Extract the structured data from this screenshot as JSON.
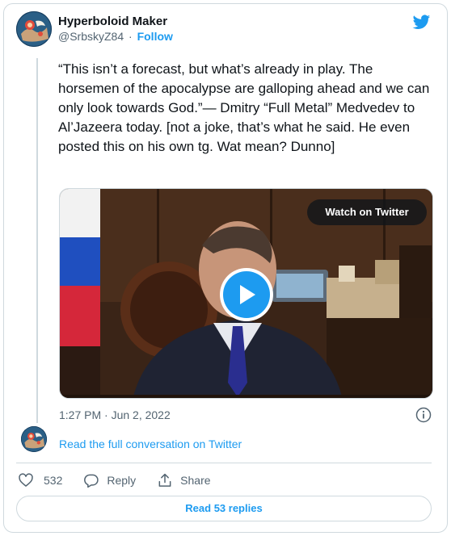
{
  "author": {
    "name": "Hyperboloid Maker",
    "handle": "@SrbskyZ84",
    "separator": "·",
    "follow_label": "Follow"
  },
  "tweet": {
    "text": "“This isn’t a forecast, but what’s already in play. The horsemen of the apocalypse are galloping ahead and we can only look towards God.”— Dmitry “Full Metal” Medvedev to Al’Jazeera today. [not a joke, that’s what he said. He even posted this on his own tg. Wat mean? Dunno]",
    "timestamp": "1:27 PM · Jun 2, 2022"
  },
  "media": {
    "watch_label": "Watch on Twitter",
    "play_icon": "play-icon"
  },
  "conversation": {
    "read_full_label": "Read the full conversation on Twitter"
  },
  "actions": {
    "like_count": "532",
    "reply_label": "Reply",
    "share_label": "Share"
  },
  "replies": {
    "label": "Read 53 replies"
  },
  "colors": {
    "accent": "#1d9bf0",
    "text": "#0f1419",
    "muted": "#536471",
    "border": "#cfd9de"
  }
}
